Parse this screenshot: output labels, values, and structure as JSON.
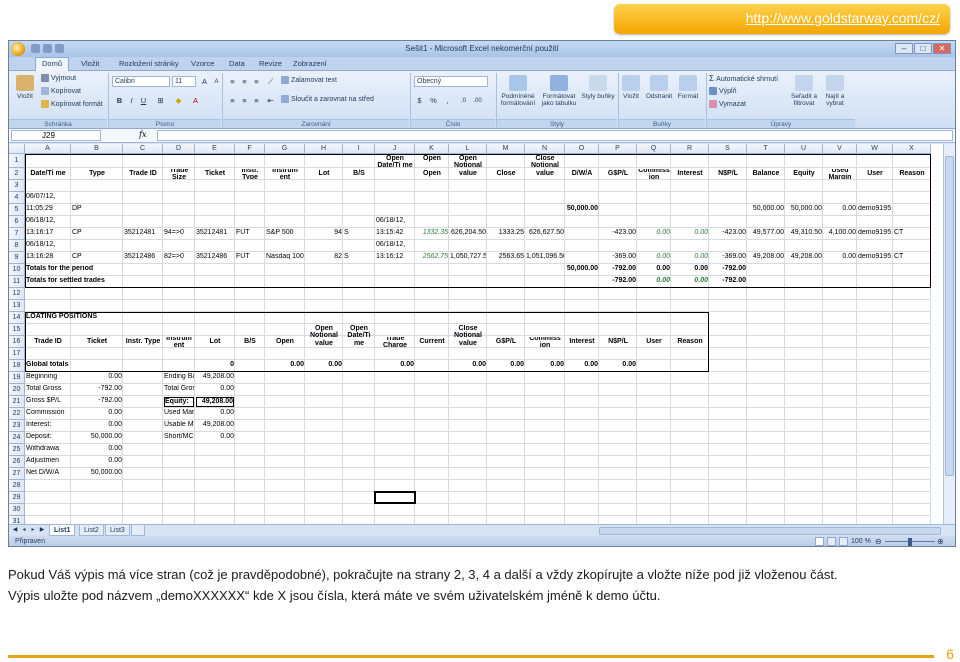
{
  "banner": {
    "url": "http://www.goldstarway.com/cz/"
  },
  "excel": {
    "title": "Sešit1 - Microsoft Excel nekomerční použití",
    "tabs": [
      "Domů",
      "Vložit",
      "Rozložení stránky",
      "Vzorce",
      "Data",
      "Revize",
      "Zobrazení"
    ],
    "ribbon": {
      "clipboard": {
        "paste": "Vložit",
        "cut": "Vyjmout",
        "copy": "Kopírovat",
        "format_painter": "Kopírovat formát",
        "label": "Schránka"
      },
      "font": {
        "name": "Calibri",
        "size": "11",
        "label": "Písmo"
      },
      "alignment": {
        "wrap": "Zalamovat text",
        "merge": "Sloučit a zarovnat na střed",
        "label": "Zarovnání"
      },
      "number": {
        "format": "Obecný",
        "label": "Číslo"
      },
      "styles": {
        "conditional": "Podmíněné formátování",
        "as_table": "Formátovat jako tabulku",
        "cell_styles": "Styly buňky",
        "label": "Styly"
      },
      "cells": {
        "insert": "Vložit",
        "delete": "Odstranit",
        "format": "Formát",
        "label": "Buňky"
      },
      "editing": {
        "autosum": "Automatické shrnutí",
        "fill": "Výplň",
        "clear": "Vymazat",
        "sort": "Seřadit a filtrovat",
        "find": "Najít a vybrat",
        "label": "Úpravy"
      }
    },
    "name_box": "J29",
    "fx": "fx",
    "columns": [
      "A",
      "B",
      "C",
      "D",
      "E",
      "F",
      "G",
      "H",
      "I",
      "J",
      "K",
      "L",
      "M",
      "N",
      "O",
      "P",
      "Q",
      "R",
      "S",
      "T",
      "U",
      "V",
      "W",
      "X"
    ],
    "rows": [
      "1",
      "2",
      "3",
      "4",
      "5",
      "6",
      "7",
      "8",
      "9",
      "10",
      "11",
      "12",
      "13",
      "14",
      "15",
      "16",
      "17",
      "18",
      "19",
      "20",
      "21",
      "22",
      "23",
      "24",
      "25",
      "26",
      "27",
      "28",
      "29",
      "30",
      "31"
    ],
    "header1": {
      "open_date": "Open Date/Ti me",
      "open": "Open",
      "open_notional": "Open Notional value",
      "close_notional": "Close Notional value",
      "date": "Date/Ti me",
      "type": "Type",
      "trade_id": "Trade ID",
      "trade_size": "Trade Size",
      "ticket": "Ticket",
      "instr_type": "Instr. Type",
      "instrument": "Instrum ent",
      "lot": "Lot",
      "bs": "B/S",
      "close": "Close",
      "dwa": "D/W/A",
      "gpl": "G$P/L",
      "commission": "Commiss ion",
      "interest": "Interest",
      "npl": "N$P/L",
      "balance": "Balance",
      "equity": "Equity",
      "used_margin": "Used Margin",
      "user": "User",
      "reason": "Reason"
    },
    "r4": {
      "a": "06/07/12,"
    },
    "r5": {
      "a": "11:05:29",
      "b": "DP",
      "o": "50,000.00",
      "t": "50,000.00",
      "u": "50,000.00",
      "v": "0.00",
      "w": "demo9195"
    },
    "r6": {
      "a": "06/18/12,",
      "j": "06/18/12,"
    },
    "r7": {
      "a": "13:16:17",
      "b": "CP",
      "c": "35212481",
      "d": "94=>0",
      "e": "35212481",
      "f": "FUT",
      "g": "S&P 500",
      "h": "94",
      "i": "S",
      "j": "13:15:42",
      "k": "1332.35",
      "l": "626,204.50",
      "m": "1333.25",
      "n": "626,627.50",
      "p": "-423.00",
      "q": "0.00",
      "r": "0.00",
      "s": "-423.00",
      "t": "49,577.00",
      "u": "49,310.50",
      "v": "4,100.00",
      "w": "demo9195",
      "x": "CT"
    },
    "r8": {
      "a": "06/18/12,",
      "j": "06/18/12,"
    },
    "r9": {
      "a": "13:16:28",
      "b": "CP",
      "c": "35212486",
      "d": "82=>0",
      "e": "35212486",
      "f": "FUT",
      "g": "Nasdaq 100",
      "h": "82",
      "i": "S",
      "j": "13:16:12",
      "k": "2562.75",
      "l": "1,050,727.50",
      "m": "2563.65",
      "n": "1,051,096.50",
      "p": "-369.00",
      "q": "0.00",
      "r": "0.00",
      "s": "-369.00",
      "t": "49,208.00",
      "u": "49,208.00",
      "v": "0.00",
      "w": "demo9195",
      "x": "CT"
    },
    "r10": {
      "a": "Totals for the period",
      "o": "50,000.00",
      "p": "-792.00",
      "q": "0.00",
      "r": "0.00",
      "s": "-792.00"
    },
    "r11": {
      "a": "Totals for settled trades",
      "p": "-792.00",
      "q": "0.00",
      "r": "0.00",
      "s": "-792.00"
    },
    "r14": {
      "a": "LOATING POSITIONS"
    },
    "header2": {
      "open_notional": "Open Notional value",
      "open_date": "Open Date/Ti me",
      "close_notional": "Close Notional value",
      "trade_id": "Trade ID",
      "ticket": "Ticket",
      "instr_type": "Instr. Type",
      "instrument": "Instrum ent",
      "lot": "Lot",
      "bs": "B/S",
      "open": "Open",
      "trade_charge": "Trade Charge",
      "current": "Current",
      "gpl": "G$P/L",
      "commission": "Commiss ion",
      "interest": "Interest",
      "npl": "N$P/L",
      "user": "User",
      "reason": "Reason"
    },
    "r18": {
      "a": "Global totals",
      "e": "0",
      "g": "0.00",
      "h": "0.00",
      "j": "0.00",
      "l": "0.00",
      "m": "0.00",
      "n": "0.00",
      "o": "0.00",
      "p": "0.00"
    },
    "summary_left": [
      {
        "label": "Beginning",
        "value": "0.00"
      },
      {
        "label": "Total Gross",
        "value": "-792.00"
      },
      {
        "label": "Gross $P/L",
        "value": "-792.00"
      },
      {
        "label": "Commission",
        "value": "0.00"
      },
      {
        "label": "Interest:",
        "value": "0.00"
      },
      {
        "label": "Deposit:",
        "value": "50,000.00"
      },
      {
        "label": "Withdrawa",
        "value": "0.00"
      },
      {
        "label": "Adjustmen",
        "value": "0.00"
      },
      {
        "label": "Net D/W/A",
        "value": "50,000.00"
      }
    ],
    "summary_right": [
      {
        "label": "Ending Bal",
        "value": "49,208.00"
      },
      {
        "label": "Total Gross",
        "value": "0.00"
      },
      {
        "label": "Equity:",
        "value": "49,208.00"
      },
      {
        "label": "Used Marg",
        "value": "0.00"
      },
      {
        "label": "Usable Ma",
        "value": "49,208.00"
      },
      {
        "label": "Short/MC L",
        "value": "0.00"
      }
    ],
    "sheet_tabs": [
      "List1",
      "List2",
      "List3"
    ],
    "status": "Připraven",
    "zoom": "100 %"
  },
  "caption": {
    "line1": "Pokud Váš výpis má více stran (což je pravděpodobné), pokračujte na strany 2, 3, 4  a další a vždy zkopírujte a vložte níže pod již vloženou část.",
    "line2": "Výpis uložte pod názvem „demoXXXXXX“ kde X jsou čísla, která máte ve svém uživatelském jméně k demo účtu."
  },
  "page_number": "6"
}
